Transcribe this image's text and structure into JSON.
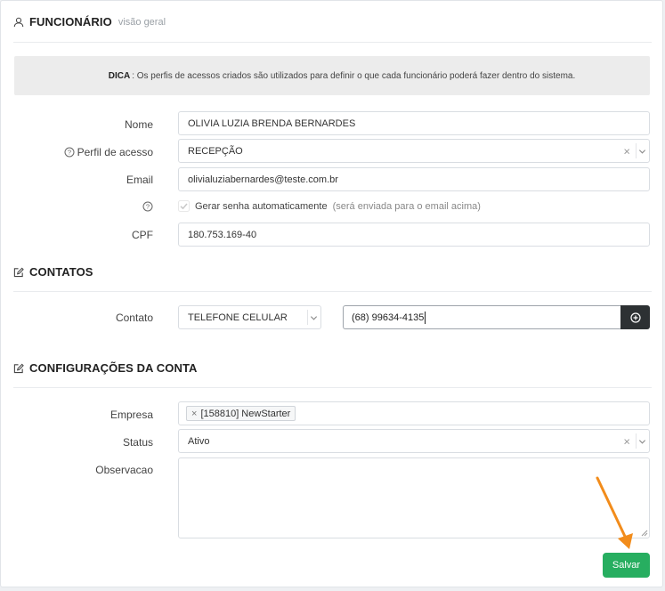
{
  "header": {
    "title": "FUNCIONÁRIO",
    "subtitle": "visão geral"
  },
  "tip": {
    "label": "DICA",
    "text": ": Os perfis de acessos criados são utilizados para definir o que cada funcionário poderá fazer dentro do sistema."
  },
  "form": {
    "nome_label": "Nome",
    "nome_value": "OLIVIA LUZIA BRENDA BERNARDES",
    "perfil_label": "Perfil de acesso",
    "perfil_value": "RECEPÇÃO",
    "email_label": "Email",
    "email_value": "olivialuziabernardes@teste.com.br",
    "gerar_senha_label": "Gerar senha automaticamente",
    "gerar_senha_hint": "(será enviada para o email acima)",
    "cpf_label": "CPF",
    "cpf_value": "180.753.169-40"
  },
  "contatos": {
    "title": "CONTATOS",
    "contato_label": "Contato",
    "tipo_value": "TELEFONE CELULAR",
    "numero_value": "(68) 99634-4135"
  },
  "config": {
    "title": "CONFIGURAÇÕES DA CONTA",
    "empresa_label": "Empresa",
    "empresa_tag": "[158810] NewStarter",
    "status_label": "Status",
    "status_value": "Ativo",
    "observacao_label": "Observacao",
    "observacao_value": ""
  },
  "actions": {
    "save_label": "Salvar"
  },
  "colors": {
    "save_button": "#27ae60",
    "add_button": "#2d3133",
    "annotation_arrow": "#f28c1b"
  },
  "icons": {
    "header": "user-icon",
    "sections": "edit-icon",
    "help": "help-circle-icon",
    "add": "plus-circle-icon"
  }
}
